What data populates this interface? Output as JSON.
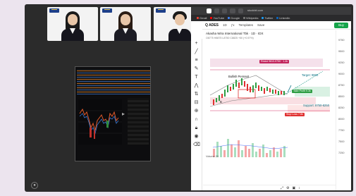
{
  "browser": {
    "url": "stockbit.com",
    "tabs": [
      "",
      "",
      "",
      "",
      ""
    ],
    "bookmarks": [
      {
        "label": "Gmail",
        "color": "#ea4335"
      },
      {
        "label": "YouTube",
        "color": "#ff0000"
      },
      {
        "label": "Google",
        "color": "#4285f4"
      },
      {
        "label": "Wikipedia",
        "color": "#777777"
      },
      {
        "label": "Twitter",
        "color": "#1d9bf0"
      },
      {
        "label": "LinkedIn",
        "color": "#0a66c2"
      }
    ]
  },
  "tradingview": {
    "symbol": "Q ADES",
    "templates_label": "Templates",
    "save_label": "Save",
    "buy_label": "Buy",
    "legend_title": "Akasha Wira International Tbk · 1D · IDX",
    "legend_sub": "O8775 H8875 L8750 C8825 +50 (+0.57%)",
    "volume_label": "Volume 20",
    "price_ticks": [
      "9750",
      "9500",
      "9250",
      "9000",
      "8750",
      "8500",
      "8250",
      "8000",
      "7750",
      "7500",
      "7250"
    ],
    "annotations": {
      "bullish_pennant": "Bullish Pennant",
      "target": "Target: 9900",
      "support": "Support: 8750-8250",
      "b_label": "B",
      "top_band": "Resist 9610-9750 · 1.4k",
      "mid_green": "Take Profit 9.3k",
      "stop": "Stop Loss 7.8k"
    }
  },
  "meeting": {
    "tiles": [
      "speaker-1",
      "speaker-2",
      "speaker-3"
    ]
  }
}
